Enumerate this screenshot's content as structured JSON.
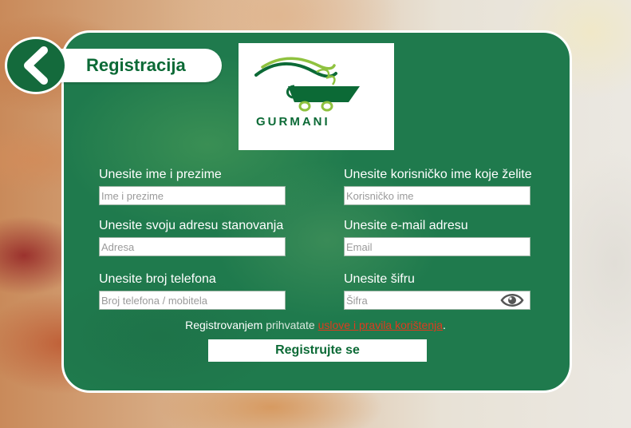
{
  "header": {
    "title": "Registracija",
    "back_icon": "chevron-left-icon"
  },
  "logo": {
    "brand_text": "GURMANI",
    "colors": {
      "green": "#0c6a36",
      "lime": "#8fc23f"
    }
  },
  "form": {
    "full_name": {
      "label": "Unesite ime i prezime",
      "placeholder": "Ime i prezime",
      "value": ""
    },
    "username": {
      "label": "Unesite korisničko ime koje želite",
      "placeholder": "Korisničko ime",
      "value": ""
    },
    "address": {
      "label": "Unesite svoju adresu stanovanja",
      "placeholder": "Adresa",
      "value": ""
    },
    "email": {
      "label": "Unesite e-mail adresu",
      "placeholder": "Email",
      "value": ""
    },
    "phone": {
      "label": "Unesite broj telefona",
      "placeholder": "Broj telefona / mobitela",
      "value": ""
    },
    "password": {
      "label": "Unesite šifru",
      "placeholder": "Šifra",
      "value": "",
      "toggle_icon": "eye-icon"
    }
  },
  "terms": {
    "prefix": "Registrovanjem",
    "middle": "prihvatate",
    "link_text": "uslove i pravila korištenja",
    "suffix": "."
  },
  "submit": {
    "label": "Registrujte se"
  },
  "colors": {
    "panel_green": "#1f7a4d",
    "accent_green": "#0c6a36",
    "link_red": "#e03a1e"
  }
}
